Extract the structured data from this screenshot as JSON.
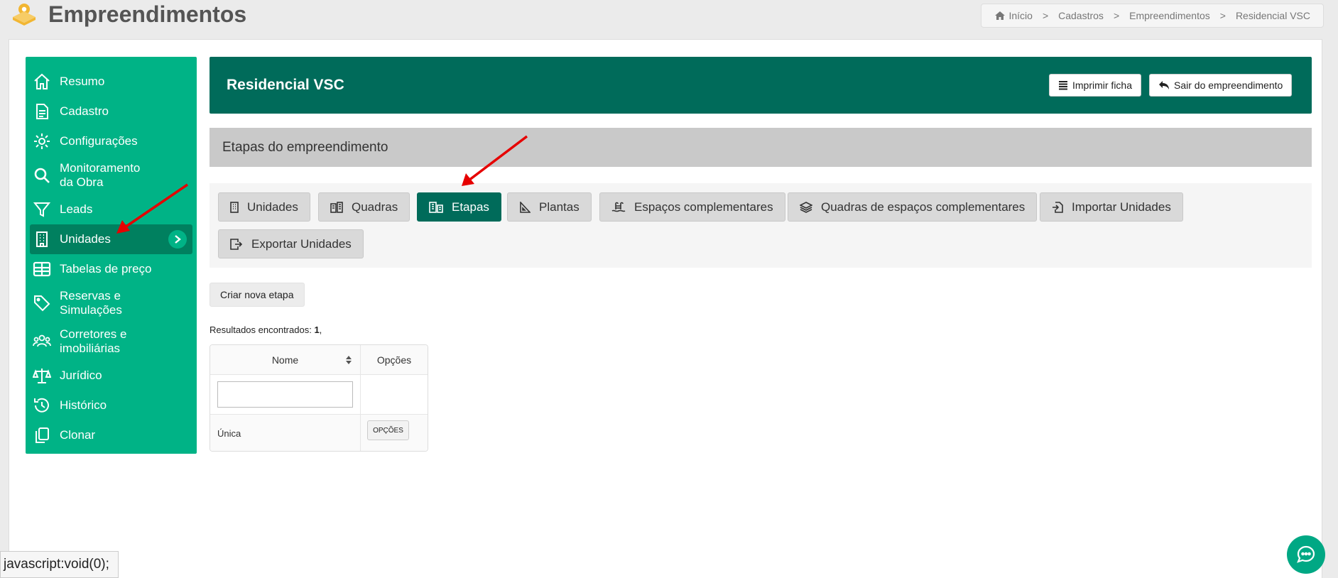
{
  "header": {
    "title": "Empreendimentos",
    "breadcrumb": [
      "Início",
      "Cadastros",
      "Empreendimentos",
      "Residencial VSC"
    ]
  },
  "sidebar": {
    "items": [
      {
        "label": "Resumo",
        "icon": "home-icon"
      },
      {
        "label": "Cadastro",
        "icon": "document-icon"
      },
      {
        "label": "Configurações",
        "icon": "gear-icon"
      },
      {
        "label": "Monitoramento da Obra",
        "icon": "search-icon"
      },
      {
        "label": "Leads",
        "icon": "filter-icon"
      },
      {
        "label": "Unidades",
        "icon": "building-icon",
        "active": true
      },
      {
        "label": "Tabelas de preço",
        "icon": "table-icon"
      },
      {
        "label": "Reservas e Simulações",
        "icon": "tag-icon"
      },
      {
        "label": "Corretores e imobiliárias",
        "icon": "users-icon"
      },
      {
        "label": "Jurídico",
        "icon": "scale-icon"
      },
      {
        "label": "Histórico",
        "icon": "history-icon"
      },
      {
        "label": "Clonar",
        "icon": "copy-icon"
      }
    ]
  },
  "project": {
    "name": "Residencial VSC",
    "print_label": "Imprimir ficha",
    "exit_label": "Sair do empreendimento"
  },
  "section": {
    "title": "Etapas do empreendimento"
  },
  "tabs": [
    {
      "label": "Unidades",
      "icon": "building-icon"
    },
    {
      "label": "Quadras",
      "icon": "blocks-icon"
    },
    {
      "label": "Etapas",
      "icon": "stages-icon",
      "active": true
    },
    {
      "label": "Plantas",
      "icon": "ruler-triangle-icon"
    },
    {
      "label": "Espaços complementares",
      "icon": "pool-icon"
    },
    {
      "label": "Quadras de espaços complementares",
      "icon": "layers-icon"
    },
    {
      "label": "Importar Unidades",
      "icon": "import-icon"
    },
    {
      "label": "Exportar Unidades",
      "icon": "export-icon"
    }
  ],
  "actions": {
    "create_label": "Criar nova etapa"
  },
  "results": {
    "prefix": "Resultados encontrados: ",
    "count": "1",
    "suffix": ","
  },
  "table": {
    "columns": [
      "Nome",
      "Opções"
    ],
    "rows": [
      {
        "nome": "Única",
        "options_label": "OPÇÕES"
      }
    ]
  },
  "status_bar": {
    "url": "javascript:void(0);"
  },
  "colors": {
    "sidebar": "#00b386",
    "sidebar_active": "#00805f",
    "project_bar": "#006b5a",
    "arrow": "#e60000"
  }
}
